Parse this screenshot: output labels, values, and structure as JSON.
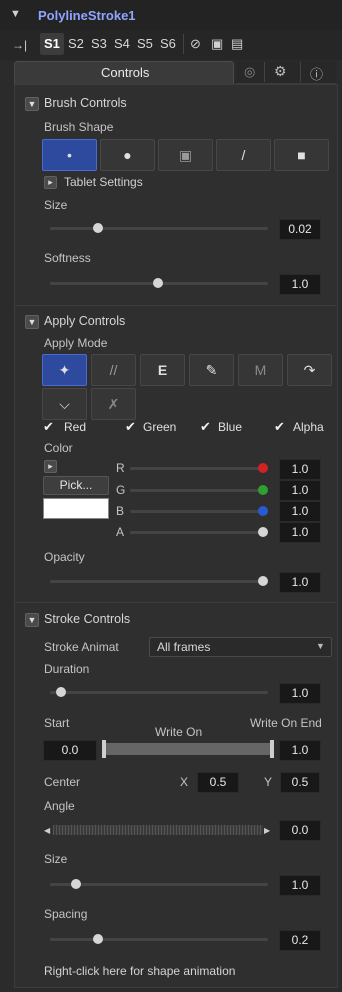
{
  "header": {
    "title": "PolylineStroke1"
  },
  "toolbar": {
    "items": [
      "S1",
      "S2",
      "S3",
      "S4",
      "S5",
      "S6"
    ]
  },
  "tabs": {
    "controls": "Controls"
  },
  "brush": {
    "section": "Brush Controls",
    "shape_label": "Brush Shape",
    "tablet": "Tablet Settings",
    "size_label": "Size",
    "size_value": "0.02",
    "softness_label": "Softness",
    "softness_value": "1.0"
  },
  "apply": {
    "section": "Apply Controls",
    "mode_label": "Apply Mode",
    "ch_red": "Red",
    "ch_green": "Green",
    "ch_blue": "Blue",
    "ch_alpha": "Alpha",
    "color_label": "Color",
    "pick": "Pick...",
    "r": "R",
    "g": "G",
    "b": "B",
    "a": "A",
    "r_val": "1.0",
    "g_val": "1.0",
    "b_val": "1.0",
    "a_val": "1.0",
    "opacity_label": "Opacity",
    "opacity_value": "1.0"
  },
  "stroke": {
    "section": "Stroke Controls",
    "anim_label": "Stroke Animat",
    "anim_value": "All frames",
    "duration_label": "Duration",
    "duration_value": "1.0",
    "start_label": "Start",
    "writeon_label": "Write On",
    "writeonend_label": "Write On End",
    "start_value": "0.0",
    "end_value": "1.0",
    "center_label": "Center",
    "x_label": "X",
    "x_value": "0.5",
    "y_label": "Y",
    "y_value": "0.5",
    "angle_label": "Angle",
    "angle_value": "0.0",
    "size_label": "Size",
    "size_value": "1.0",
    "spacing_label": "Spacing",
    "spacing_value": "0.2"
  },
  "footer": {
    "text": "Right-click here for shape animation"
  }
}
